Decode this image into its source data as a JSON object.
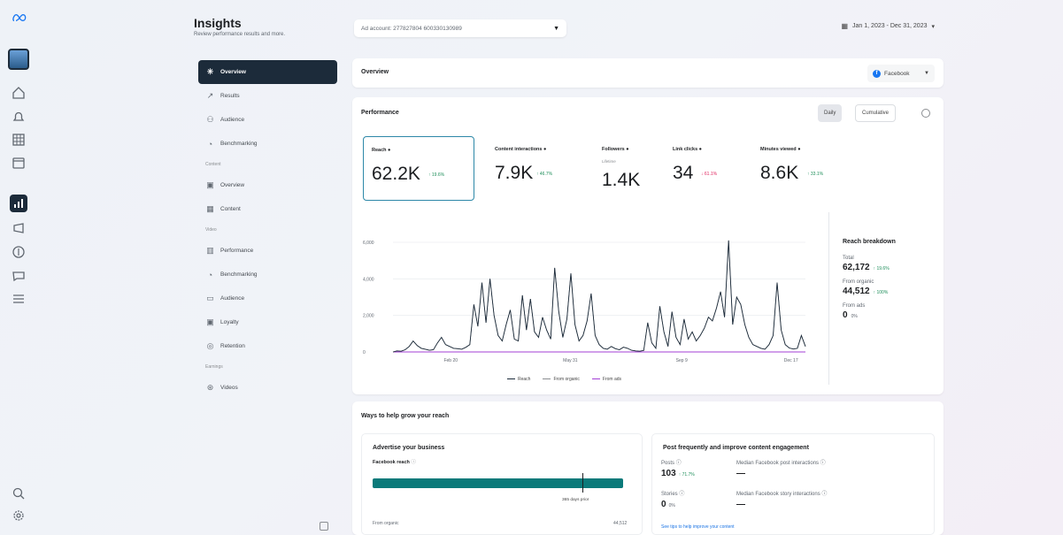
{
  "header": {
    "title": "Insights",
    "subtitle": "Review performance results and more.",
    "account_selector": "Ad account: 277827804 600330130989",
    "date_range": "Jan 1, 2023 - Dec 31, 2023"
  },
  "nav": {
    "items_top": [
      {
        "label": "Overview",
        "icon": "sparkle-icon",
        "active": true
      },
      {
        "label": "Results",
        "icon": "trend-icon"
      },
      {
        "label": "Audience",
        "icon": "audience-icon"
      },
      {
        "label": "Benchmarking",
        "icon": "benchmark-icon"
      }
    ],
    "content_section": "Content",
    "content_items": [
      {
        "label": "Overview",
        "icon": "overview-icon"
      },
      {
        "label": "Content",
        "icon": "grid-icon"
      }
    ],
    "video_section": "Video",
    "video_items": [
      {
        "label": "Performance",
        "icon": "performance-icon"
      },
      {
        "label": "Benchmarking",
        "icon": "benchmark-icon"
      },
      {
        "label": "Audience",
        "icon": "audience-icon"
      },
      {
        "label": "Loyalty",
        "icon": "loyalty-icon"
      },
      {
        "label": "Retention",
        "icon": "retention-icon"
      }
    ],
    "earnings_section": "Earnings",
    "earnings_items": [
      {
        "label": "Videos",
        "icon": "dollar-icon"
      }
    ]
  },
  "overview_bar": {
    "title": "Overview",
    "platform": "Facebook"
  },
  "performance": {
    "title": "Performance",
    "toggle_daily": "Daily",
    "toggle_cumulative": "Cumulative",
    "metrics": [
      {
        "label": "Reach",
        "value": "62.2K",
        "change": "↑ 19.6%",
        "trend": "up"
      },
      {
        "label": "Content interactions",
        "value": "7.9K",
        "change": "↑ 46.7%",
        "trend": "up"
      },
      {
        "label": "Followers",
        "sub": "Lifetime",
        "value": "1.4K",
        "change": "",
        "trend": "neutral"
      },
      {
        "label": "Link clicks",
        "value": "34",
        "change": "↓ 61.1%",
        "trend": "down"
      },
      {
        "label": "Minutes viewed",
        "value": "8.6K",
        "change": "↑ 33.1%",
        "trend": "up"
      }
    ],
    "breakdown": {
      "title": "Reach breakdown",
      "total_label": "Total",
      "total_value": "62,172",
      "total_change": "↑ 19.6%",
      "organic_label": "From organic",
      "organic_value": "44,512",
      "organic_change": "↑ 100%",
      "ads_label": "From ads",
      "ads_value": "0",
      "ads_change": "0%"
    },
    "legend": [
      "Reach",
      "From organic",
      "From ads"
    ]
  },
  "chart_data": {
    "type": "line",
    "x_ticks": [
      "Feb 20",
      "May 31",
      "Sep 9",
      "Dec 17"
    ],
    "y_ticks": [
      "0",
      "2,000",
      "4,000",
      "6,000"
    ],
    "ylim": [
      0,
      6000
    ],
    "series": [
      {
        "name": "Reach",
        "color": "#1c2b3a"
      },
      {
        "name": "From organic",
        "color": "#8a8d91"
      },
      {
        "name": "From ads",
        "color": "#a33fd6"
      }
    ],
    "reach_values": [
      0,
      60,
      40,
      120,
      300,
      600,
      350,
      200,
      150,
      90,
      120,
      500,
      800,
      400,
      300,
      200,
      180,
      150,
      250,
      400,
      2600,
      1400,
      3800,
      1600,
      4000,
      2000,
      900,
      600,
      1500,
      2300,
      700,
      600,
      3100,
      1200,
      2900,
      1100,
      800,
      1900,
      1200,
      700,
      4600,
      2200,
      800,
      1800,
      4300,
      1500,
      600,
      900,
      1700,
      3200,
      900,
      400,
      200,
      150,
      300,
      180,
      120,
      260,
      200,
      90,
      60,
      40,
      80,
      1600,
      500,
      200,
      2500,
      1100,
      300,
      2200,
      800,
      400,
      1800,
      700,
      1100,
      600,
      900,
      1300,
      1900,
      1700,
      2400,
      3300,
      1900,
      6100,
      1500,
      3000,
      2600,
      1500,
      800,
      400,
      300,
      200,
      150,
      400,
      900,
      3800,
      1200,
      400,
      220,
      160,
      200,
      900,
      300
    ],
    "ads_values": [
      0,
      0
    ]
  },
  "ways": {
    "title": "Ways to help grow your reach",
    "advertise": {
      "title": "Advertise your business",
      "reach_label": "Facebook reach",
      "bar_fill_fraction": 1.0,
      "marker_label": "365 days prior",
      "organic_label": "From organic",
      "organic_value": "44,512"
    },
    "post": {
      "title": "Post frequently and improve content engagement",
      "posts_label": "Posts",
      "posts_value": "103",
      "posts_change": "↑ 71.7%",
      "median_post_label": "Median Facebook post interactions",
      "median_post_value": "—",
      "stories_label": "Stories",
      "stories_value": "0",
      "stories_change": "0%",
      "median_story_label": "Median Facebook story interactions",
      "median_story_value": "—",
      "tips_link": "See tips to help improve your content"
    }
  }
}
